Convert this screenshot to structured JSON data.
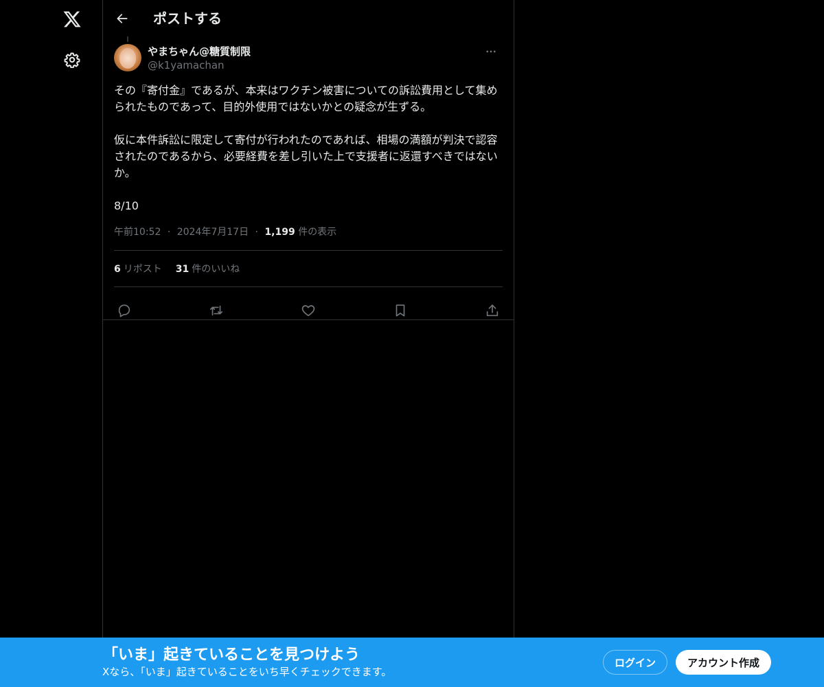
{
  "header": {
    "title": "ポストする"
  },
  "post": {
    "author_name": "やまちゃん@糖質制限",
    "author_handle": "@k1yamachan",
    "text": "その『寄付金』であるが、本来はワクチン被害についての訴訟費用として集められたものであって、目的外使用ではないかとの疑念が生ずる。\n\n仮に本件訴訟に限定して寄付が行われたのであれば、相場の満額が判決で認容されたのであるから、必要経費を差し引いた上で支援者に返還すべきではないか。\n\n8/10",
    "time": "午前10:52",
    "date": "2024年7月17日",
    "separator": "·",
    "views_count": "1,199",
    "views_label": "件の表示",
    "reposts_count": "6",
    "reposts_label": "リポスト",
    "likes_count": "31",
    "likes_label": "件のいいね"
  },
  "banner": {
    "title": "「いま」起きていることを見つけよう",
    "subtitle": "Xなら、「いま」起きていることをいち早くチェックできます。",
    "login_label": "ログイン",
    "signup_label": "アカウント作成"
  },
  "colors": {
    "background": "#000000",
    "text_primary": "#e7e9ea",
    "text_secondary": "#71767b",
    "border": "#2f3336",
    "accent": "#1d9bf0"
  },
  "icons": {
    "logo": "x-logo-icon",
    "settings": "gear-icon",
    "back": "arrow-left-icon",
    "more": "more-horizontal-icon",
    "reply": "reply-icon",
    "repost": "repost-icon",
    "like": "heart-icon",
    "bookmark": "bookmark-icon",
    "share": "share-icon"
  }
}
